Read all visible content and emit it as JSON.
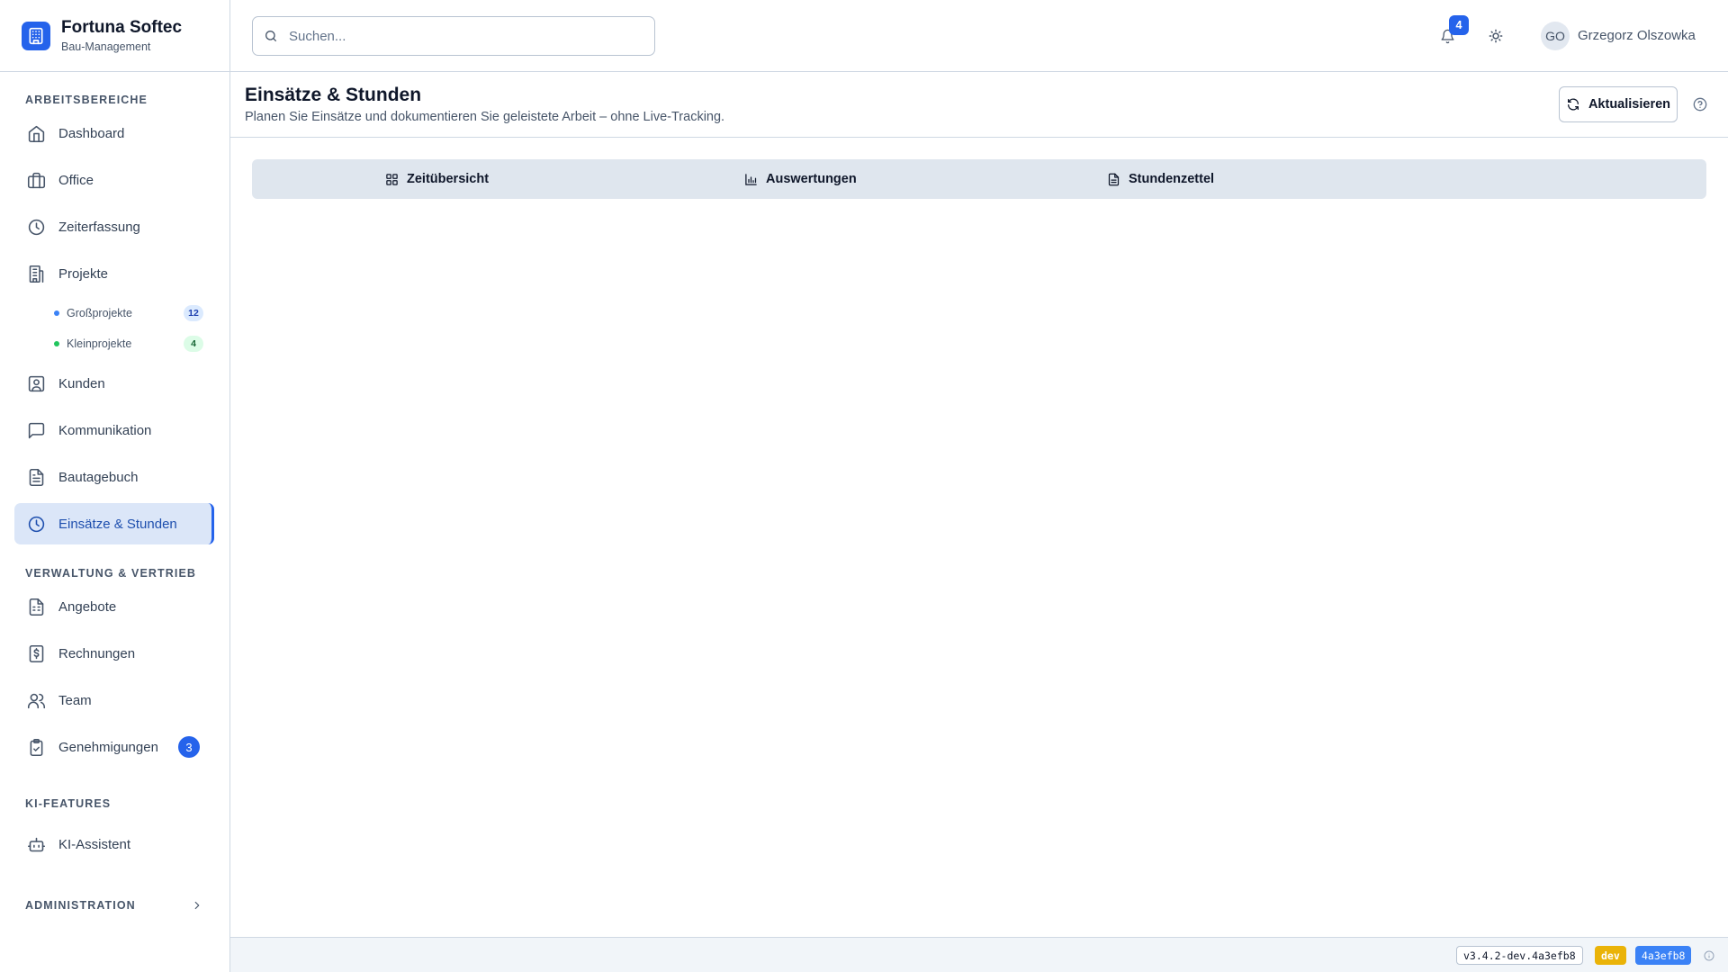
{
  "brand": {
    "title": "Fortuna Softec",
    "subtitle": "Bau-Management"
  },
  "sidebar": {
    "sections": [
      {
        "label": "Arbeitsbereiche"
      },
      {
        "label": "Verwaltung & Vertrieb"
      },
      {
        "label": "KI-Features"
      },
      {
        "label": "Administration"
      }
    ],
    "items": [
      {
        "label": "Dashboard",
        "icon": "home-icon"
      },
      {
        "label": "Office",
        "icon": "building-icon"
      },
      {
        "label": "Zeiterfassung",
        "icon": "clock-icon"
      },
      {
        "label": "Projekte",
        "icon": "buildings-icon"
      },
      {
        "label": "Kunden",
        "icon": "contact-icon"
      },
      {
        "label": "Kommunikation",
        "icon": "chat-icon"
      },
      {
        "label": "Bautagebuch",
        "icon": "document-icon"
      },
      {
        "label": "Einsätze & Stunden",
        "icon": "clock-icon",
        "active": true
      },
      {
        "label": "Angebote",
        "icon": "spreadsheet-icon"
      },
      {
        "label": "Rechnungen",
        "icon": "invoice-icon"
      },
      {
        "label": "Team",
        "icon": "users-icon"
      },
      {
        "label": "Genehmigungen",
        "icon": "clipboard-check-icon",
        "badge": "3"
      },
      {
        "label": "KI-Assistent",
        "icon": "bot-icon"
      }
    ],
    "project_subitems": [
      {
        "label": "Großprojekte",
        "count": "12",
        "color": "#3b82f6"
      },
      {
        "label": "Kleinprojekte",
        "count": "4",
        "color": "#22c55e"
      }
    ]
  },
  "topbar": {
    "search_placeholder": "Suchen...",
    "notification_count": "4",
    "user_initials": "GO",
    "user_name": "Grzegorz Olszowka"
  },
  "page": {
    "title": "Einsätze & Stunden",
    "description": "Planen Sie Einsätze und dokumentieren Sie geleistete Arbeit – ohne Live-Tracking.",
    "refresh_label": "Aktualisieren"
  },
  "tabs": [
    {
      "label": "Zeitübersicht",
      "icon": "grid-icon"
    },
    {
      "label": "Auswertungen",
      "icon": "bar-chart-icon"
    },
    {
      "label": "Stundenzettel",
      "icon": "file-text-icon"
    }
  ],
  "footer": {
    "version": "v3.4.2-dev.4a3efb8",
    "env": "dev",
    "hash": "4a3efb8"
  },
  "colors": {
    "accent": "#2563eb",
    "env_badge": "#eab308",
    "hash_badge": "#3b82f6"
  }
}
